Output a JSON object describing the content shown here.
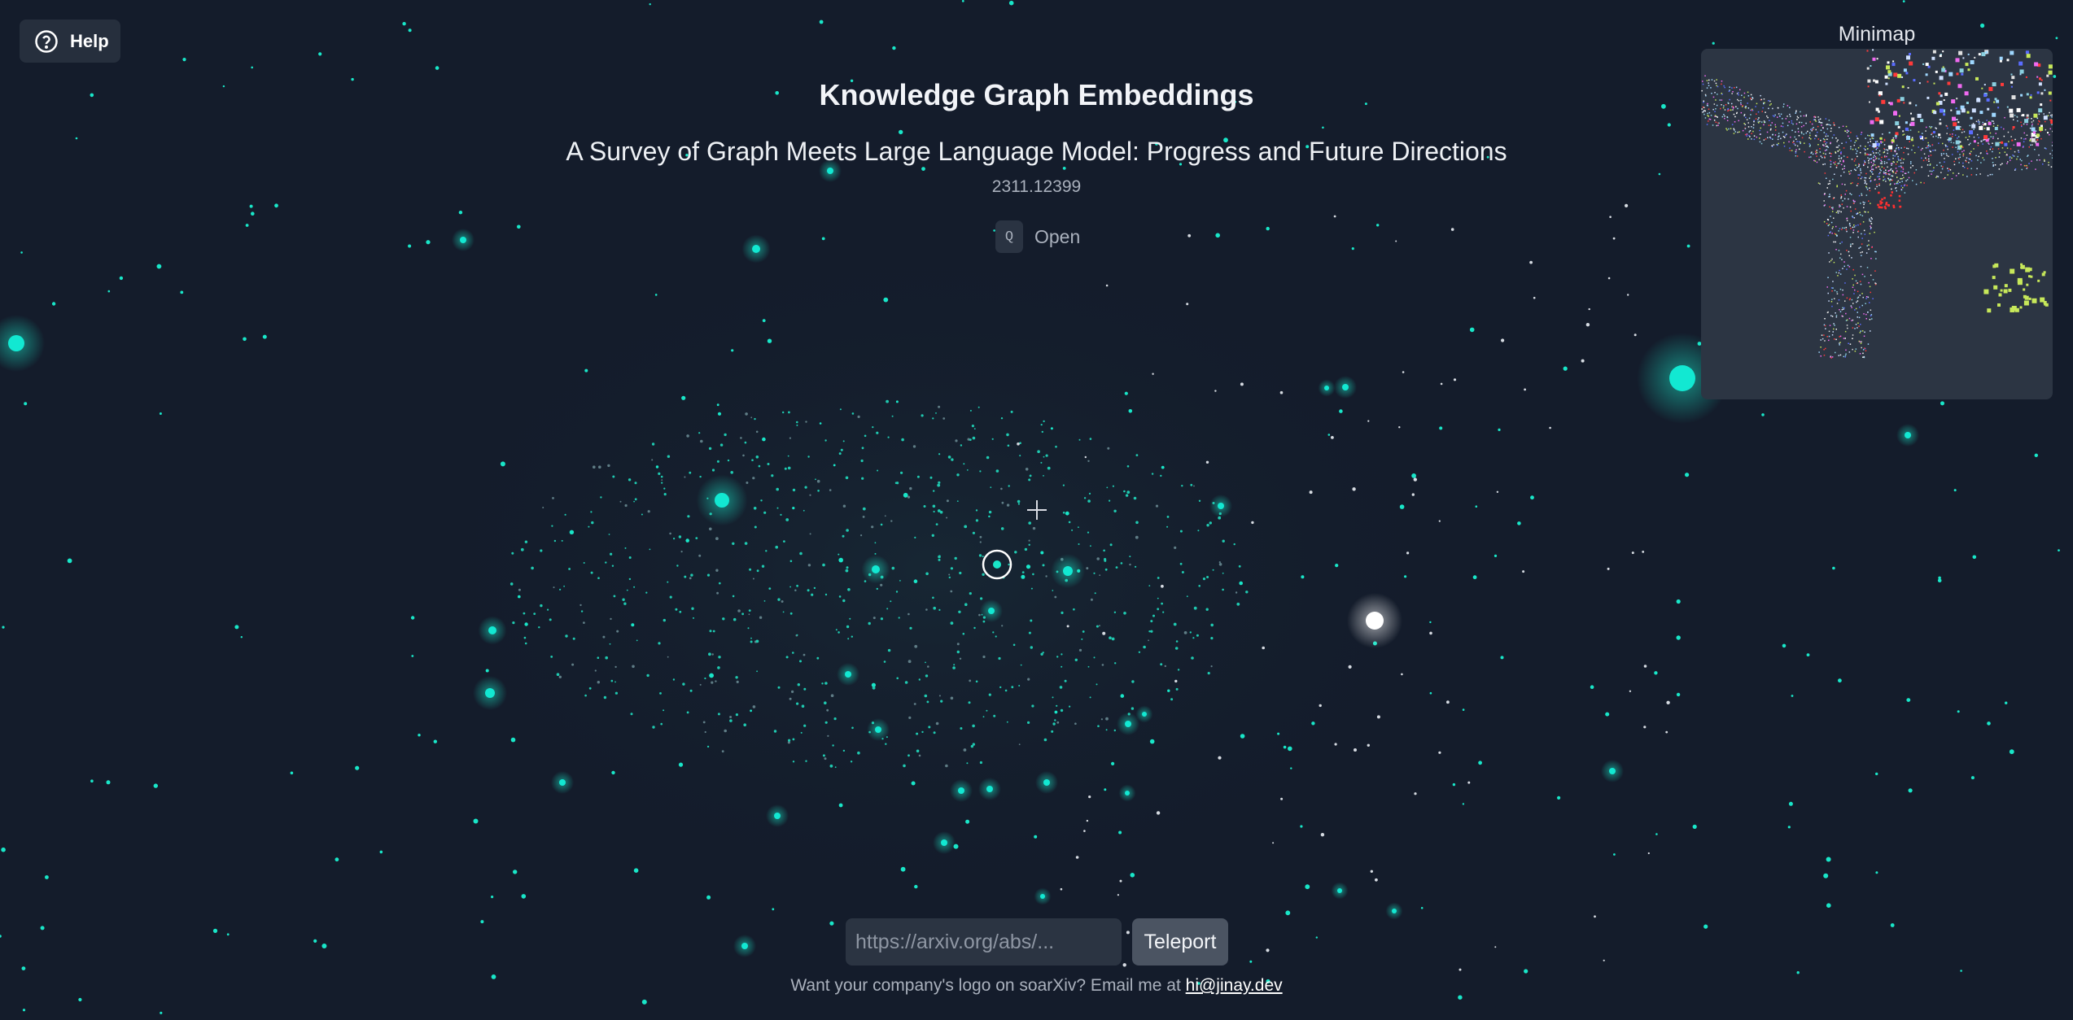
{
  "help": {
    "label": "Help",
    "icon": "question-circle-icon"
  },
  "header": {
    "title": "Knowledge Graph Embeddings",
    "paper_title": "A Survey of Graph Meets Large Language Model: Progress and Future Directions",
    "paper_id": "2311.12399",
    "open_key": "Q",
    "open_label": "Open"
  },
  "minimap": {
    "label": "Minimap"
  },
  "teleport": {
    "placeholder": "https://arxiv.org/abs/...",
    "button_label": "Teleport"
  },
  "footer": {
    "text": "Want your company's logo on soarXiv? Email me at ",
    "email": "hi@jinay.dev"
  },
  "colors": {
    "background": "#141c2b",
    "node": "#19e6c8",
    "bright_node": "#00f0e0",
    "selected_node": "#ffffff",
    "panel": "#262f3d"
  }
}
